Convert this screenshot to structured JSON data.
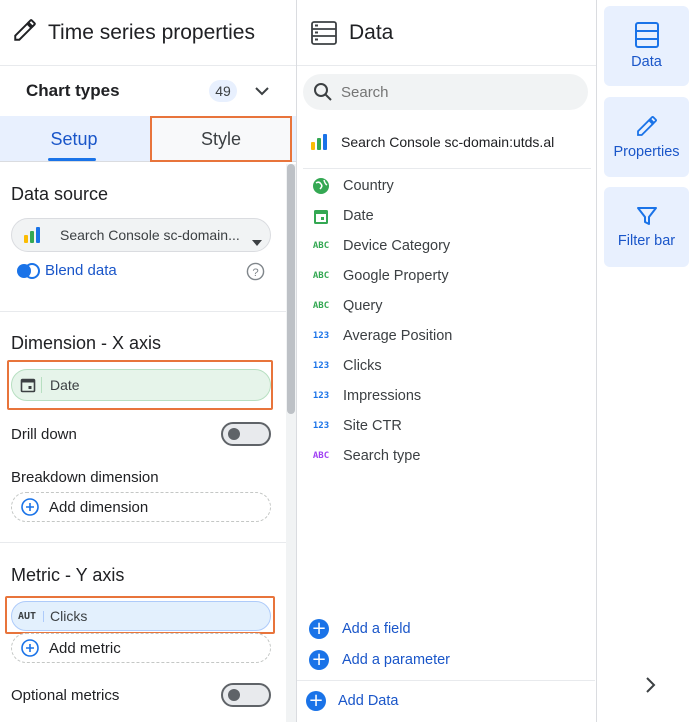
{
  "left": {
    "title": "Time series properties",
    "chart_types_label": "Chart types",
    "chart_types_count": "49",
    "tabs": {
      "setup": "Setup",
      "style": "Style"
    },
    "data_source": {
      "title": "Data source",
      "value": "Search Console sc-domain...",
      "blend": "Blend data"
    },
    "dimension": {
      "title": "Dimension - X axis",
      "value": "Date",
      "drill_down": "Drill down",
      "breakdown_title": "Breakdown dimension",
      "add_dimension": "Add dimension"
    },
    "metric": {
      "title": "Metric - Y axis",
      "badge": "AUT",
      "value": "Clicks",
      "add_metric": "Add metric",
      "optional": "Optional metrics"
    }
  },
  "mid": {
    "title": "Data",
    "search_placeholder": "Search",
    "source": "Search Console sc-domain:utds.al",
    "fields": [
      {
        "label": "Country",
        "icon": "globe-icon"
      },
      {
        "label": "Date",
        "icon": "calendar-icon"
      },
      {
        "label": "Device Category",
        "icon": "ABC"
      },
      {
        "label": "Google Property",
        "icon": "ABC"
      },
      {
        "label": "Query",
        "icon": "ABC"
      },
      {
        "label": "Average Position",
        "icon": "123"
      },
      {
        "label": "Clicks",
        "icon": "123"
      },
      {
        "label": "Impressions",
        "icon": "123"
      },
      {
        "label": "Site CTR",
        "icon": "123"
      },
      {
        "label": "Search type",
        "icon": "ABC"
      }
    ],
    "add_field": "Add a field",
    "add_parameter": "Add a parameter",
    "add_data": "Add Data"
  },
  "right": {
    "data": "Data",
    "properties": "Properties",
    "filter_bar": "Filter bar"
  },
  "colors": {
    "accent": "#1a73e8",
    "highlight": "#e8743b",
    "tab_bg": "#e8f0fe"
  }
}
